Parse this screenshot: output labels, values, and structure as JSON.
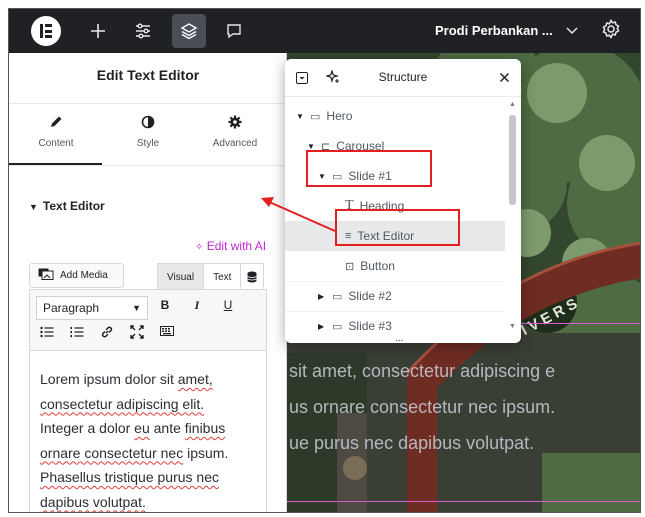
{
  "topbar": {
    "site_title": "Prodi Perbankan ...",
    "icons": [
      "elementor-logo-icon",
      "plus-icon",
      "sliders-icon",
      "layers-icon",
      "comment-icon",
      "chevron-down-icon",
      "gear-icon"
    ]
  },
  "left_panel": {
    "title": "Edit Text Editor",
    "tabs": [
      {
        "label": "Content",
        "icon": "pencil-icon",
        "active": true
      },
      {
        "label": "Style",
        "icon": "contrast-icon",
        "active": false
      },
      {
        "label": "Advanced",
        "icon": "gear-icon",
        "active": false
      }
    ],
    "section_title": "Text Editor",
    "ai_link": "Edit with AI",
    "add_media": "Add Media",
    "mode_visual": "Visual",
    "mode_text": "Text",
    "format_select": "Paragraph",
    "toolbar_buttons": [
      "B",
      "I",
      "U"
    ],
    "content": {
      "w1": "Lorem ipsum dolor sit ",
      "w2": "amet,",
      "w3": "consectetur adipiscing elit.",
      "w4": "Integer a dolor ",
      "w5": "eu",
      "w6": " ante ",
      "w7": "finibus",
      "w8": "ornare consectetur nec",
      "w9": " ipsum.",
      "w10": "Phasellus tristique purus nec",
      "w11": "dapibus volutpat."
    }
  },
  "preview": {
    "lines": [
      "sit amet, consectetur adipiscing e",
      "us ornare consectetur nec ipsum.",
      "ue purus nec dapibus volutpat."
    ],
    "arch_text": "NIVERS"
  },
  "structure": {
    "title": "Structure",
    "rows": [
      {
        "label": "Hero",
        "caret": "▼"
      },
      {
        "label": "Carousel",
        "caret": "▼"
      },
      {
        "label": "Slide #1",
        "caret": "▼"
      },
      {
        "label": "Heading",
        "caret": ""
      },
      {
        "label": "Text Editor",
        "caret": ""
      },
      {
        "label": "Button",
        "caret": ""
      },
      {
        "label": "Slide #2",
        "caret": "▶"
      },
      {
        "label": "Slide #3",
        "caret": "▶"
      }
    ],
    "more": "...",
    "colors": {
      "highlight": "#e6e8ea",
      "annotation": "#e41f1f"
    }
  }
}
